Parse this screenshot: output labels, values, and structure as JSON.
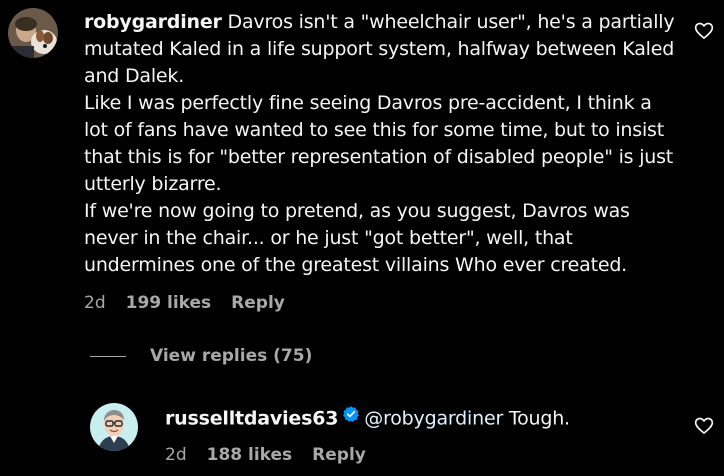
{
  "comment": {
    "username": "robygardiner",
    "line1": "Davros isn't a \"wheelchair user\", he's a partially",
    "line2": "mutated Kaled in a life support system, halfway between Kaled",
    "line3": "and Dalek.",
    "line4": "Like I was perfectly fine seeing Davros pre-accident, I think a",
    "line5": "lot of fans have wanted to see this for some time, but to insist",
    "line6": "that this is for \"better representation of disabled people\" is just",
    "line7": "utterly bizarre.",
    "line8": "If we're now going to pretend, as you suggest, Davros was",
    "line9": "never in the chair... or he just \"got better\", well, that",
    "line10": "undermines one of the greatest villains Who ever created.",
    "time": "2d",
    "likes": "199 likes",
    "reply_label": "Reply",
    "like_icon": "heart-outline-icon"
  },
  "view_replies": {
    "label": "View replies (75)"
  },
  "reply": {
    "username": "russelltdavies63",
    "verified_icon": "verified-badge-icon",
    "mention": "@robygardiner",
    "text": "Tough.",
    "time": "2d",
    "likes": "188 likes",
    "reply_label": "Reply",
    "like_icon": "heart-outline-icon"
  },
  "colors": {
    "background": "#000000",
    "text": "#f5f5f5",
    "secondary": "#a8a8a8",
    "verified": "#0095f6"
  }
}
